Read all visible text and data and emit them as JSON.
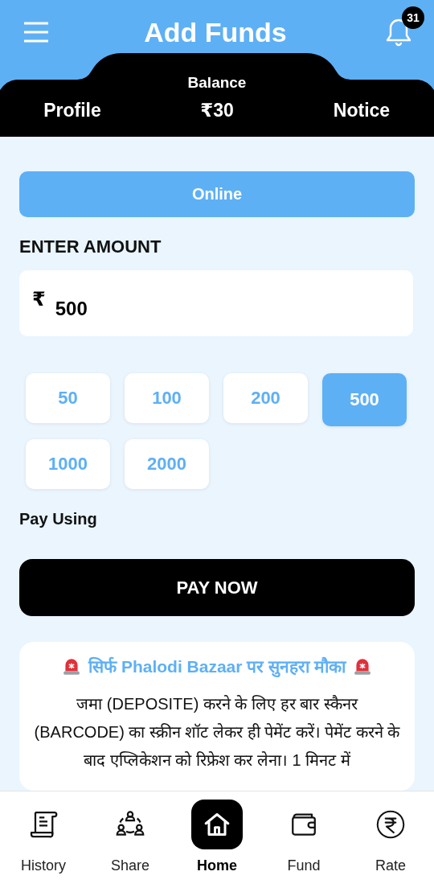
{
  "header": {
    "title": "Add Funds",
    "notification_count": "31",
    "balance_label": "Balance",
    "balance": "₹30",
    "left_link": "Profile",
    "right_link": "Notice"
  },
  "method_button": "Online",
  "amount_label": "ENTER AMOUNT",
  "amount_field": {
    "currency": "₹",
    "value": "500"
  },
  "amount_chips": [
    {
      "label": "50",
      "selected": false
    },
    {
      "label": "100",
      "selected": false
    },
    {
      "label": "200",
      "selected": false
    },
    {
      "label": "500",
      "selected": true
    },
    {
      "label": "1000",
      "selected": false
    },
    {
      "label": "2000",
      "selected": false
    }
  ],
  "pay_using_label": "Pay Using",
  "pay_button": "PAY NOW",
  "notice": {
    "title": "सिर्फ Phalodi Bazaar पर सुनहरा मौका",
    "body": "जमा (DEPOSITE) करने के लिए हर बार स्कैनर (BARCODE) का स्क्रीन शॉट लेकर ही पेमेंट करें। पेमेंट करने के बाद एप्लिकेशन को रिफ्रेश कर लेना। 1 मिनट में"
  },
  "bottom_nav": [
    {
      "kind": "history",
      "label": "History",
      "selected": false
    },
    {
      "kind": "share",
      "label": "Share",
      "selected": false
    },
    {
      "kind": "home",
      "label": "Home",
      "selected": true
    },
    {
      "kind": "fund",
      "label": "Fund",
      "selected": false
    },
    {
      "kind": "rate",
      "label": "Rate",
      "selected": false
    }
  ]
}
